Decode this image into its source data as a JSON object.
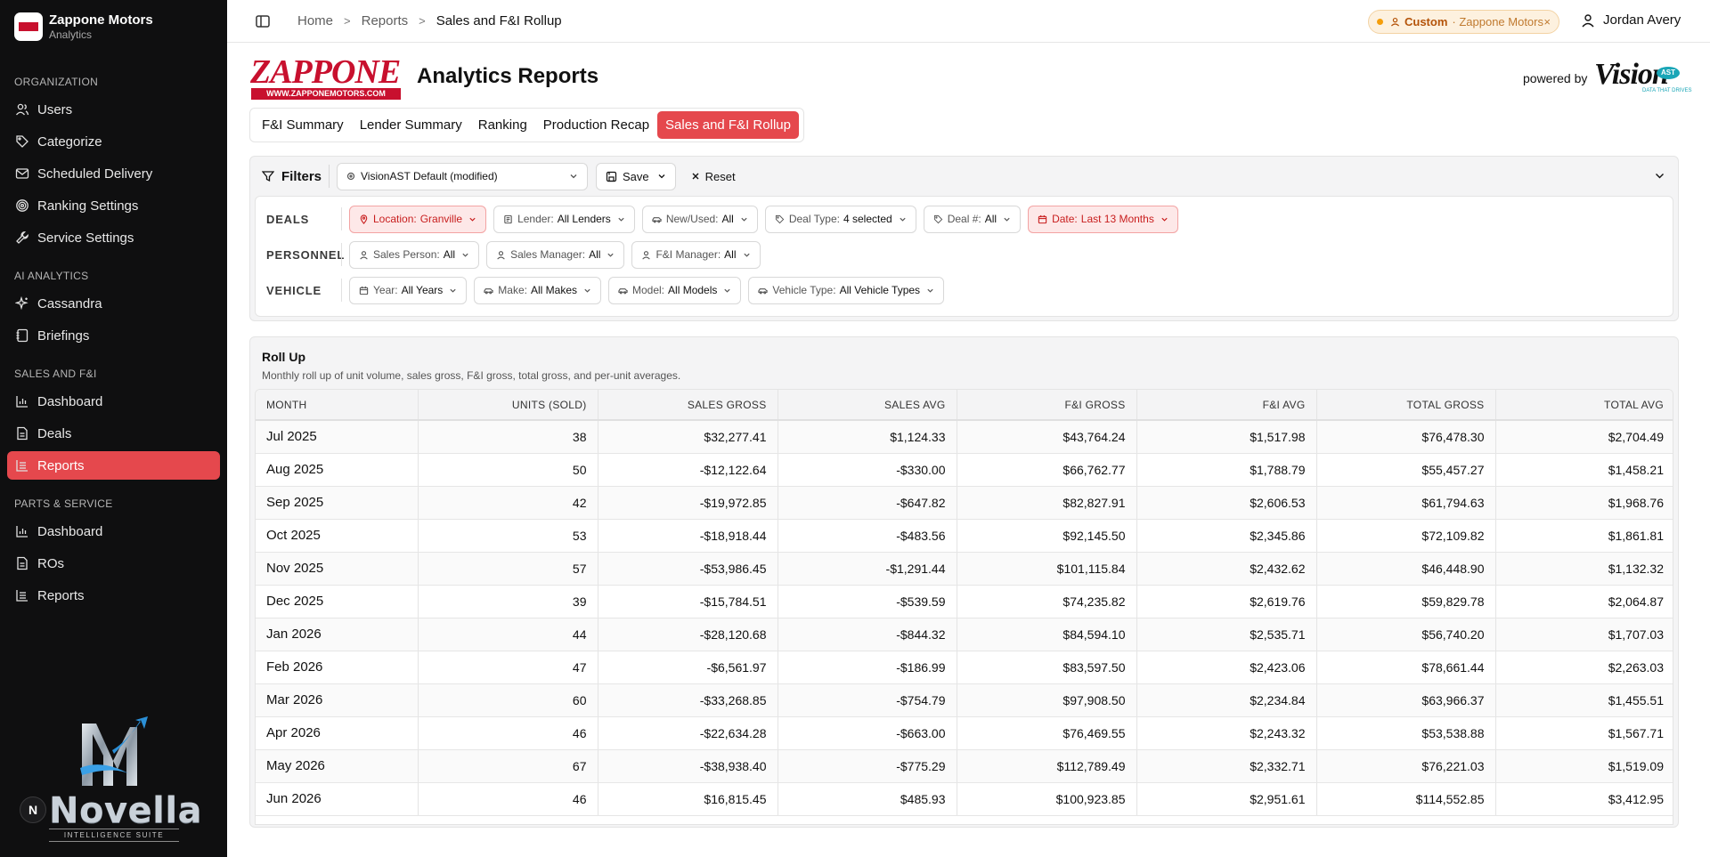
{
  "app": {
    "name": "Zappone Motors",
    "sub": "Analytics"
  },
  "sidebar": {
    "sections": [
      {
        "heading": "ORGANIZATION",
        "items": [
          {
            "label": "Users",
            "icon": "users-icon"
          },
          {
            "label": "Categorize",
            "icon": "tag-icon"
          },
          {
            "label": "Scheduled Delivery",
            "icon": "mail-icon"
          },
          {
            "label": "Ranking Settings",
            "icon": "target-icon"
          },
          {
            "label": "Service Settings",
            "icon": "wrench-icon"
          }
        ]
      },
      {
        "heading": "AI ANALYTICS",
        "items": [
          {
            "label": "Cassandra",
            "icon": "sparkles-icon"
          },
          {
            "label": "Briefings",
            "icon": "notebook-icon"
          }
        ]
      },
      {
        "heading": "SALES AND F&I",
        "items": [
          {
            "label": "Dashboard",
            "icon": "bar-chart-icon"
          },
          {
            "label": "Deals",
            "icon": "document-icon"
          },
          {
            "label": "Reports",
            "icon": "line-chart-icon",
            "active": true
          }
        ]
      },
      {
        "heading": "PARTS & SERVICE",
        "items": [
          {
            "label": "Dashboard",
            "icon": "bar-chart-icon"
          },
          {
            "label": "ROs",
            "icon": "document-icon"
          },
          {
            "label": "Reports",
            "icon": "line-chart-icon"
          }
        ]
      }
    ],
    "footer": {
      "brand": "Novella",
      "tagline": "INTELLIGENCE SUITE",
      "user_initial": "N"
    }
  },
  "topbar": {
    "breadcrumb": [
      "Home",
      "Reports",
      "Sales and F&I Rollup"
    ],
    "badge": {
      "strong": "Custom",
      "muted": "· Zappone Motors",
      "close": "×"
    },
    "user": "Jordan Avery"
  },
  "header": {
    "logo_text": "ZAPPONE",
    "logo_url": "WWW.ZAPPONEMOTORS.COM",
    "title": "Analytics Reports",
    "powered_by": "powered by",
    "partner": {
      "word": "Vision",
      "badge": "AST",
      "tagline": "DATA THAT DRIVES"
    }
  },
  "tabs": [
    {
      "label": "F&I Summary"
    },
    {
      "label": "Lender Summary"
    },
    {
      "label": "Ranking"
    },
    {
      "label": "Production Recap"
    },
    {
      "label": "Sales and F&I Rollup",
      "active": true
    }
  ],
  "filters": {
    "label": "Filters",
    "preset": "VisionAST Default (modified)",
    "save": "Save",
    "reset": "Reset",
    "rows": [
      {
        "label": "DEALS",
        "chips": [
          {
            "key": "Location:",
            "value": "Granville",
            "icon": "pin-icon",
            "highlight": true
          },
          {
            "key": "Lender:",
            "value": "All Lenders",
            "icon": "bank-icon"
          },
          {
            "key": "New/Used:",
            "value": "All",
            "icon": "car-icon"
          },
          {
            "key": "Deal Type:",
            "value": "4 selected",
            "icon": "tag-icon"
          },
          {
            "key": "Deal #:",
            "value": "All",
            "icon": "tag-icon"
          },
          {
            "key": "Date:",
            "value": "Last 13 Months",
            "icon": "calendar-icon",
            "highlight": true
          }
        ]
      },
      {
        "label": "PERSONNEL",
        "chips": [
          {
            "key": "Sales Person:",
            "value": "All",
            "icon": "person-icon"
          },
          {
            "key": "Sales Manager:",
            "value": "All",
            "icon": "person-icon"
          },
          {
            "key": "F&I Manager:",
            "value": "All",
            "icon": "person-icon"
          }
        ]
      },
      {
        "label": "VEHICLE",
        "chips": [
          {
            "key": "Year:",
            "value": "All Years",
            "icon": "calendar-icon"
          },
          {
            "key": "Make:",
            "value": "All Makes",
            "icon": "car-icon"
          },
          {
            "key": "Model:",
            "value": "All Models",
            "icon": "car-icon"
          },
          {
            "key": "Vehicle Type:",
            "value": "All Vehicle Types",
            "icon": "car-icon"
          }
        ]
      }
    ]
  },
  "rollup": {
    "title": "Roll Up",
    "description": "Monthly roll up of unit volume, sales gross, F&I gross, total gross, and per-unit averages.",
    "columns": [
      "MONTH",
      "UNITS (SOLD)",
      "SALES GROSS",
      "SALES AVG",
      "F&I GROSS",
      "F&I AVG",
      "TOTAL GROSS",
      "TOTAL AVG"
    ],
    "rows": [
      [
        "Jul 2025",
        "38",
        "$32,277.41",
        "$1,124.33",
        "$43,764.24",
        "$1,517.98",
        "$76,478.30",
        "$2,704.49"
      ],
      [
        "Aug 2025",
        "50",
        "-$12,122.64",
        "-$330.00",
        "$66,762.77",
        "$1,788.79",
        "$55,457.27",
        "$1,458.21"
      ],
      [
        "Sep 2025",
        "42",
        "-$19,972.85",
        "-$647.82",
        "$82,827.91",
        "$2,606.53",
        "$61,794.63",
        "$1,968.76"
      ],
      [
        "Oct 2025",
        "53",
        "-$18,918.44",
        "-$483.56",
        "$92,145.50",
        "$2,345.86",
        "$72,109.82",
        "$1,861.81"
      ],
      [
        "Nov 2025",
        "57",
        "-$53,986.45",
        "-$1,291.44",
        "$101,115.84",
        "$2,432.62",
        "$46,448.90",
        "$1,132.32"
      ],
      [
        "Dec 2025",
        "39",
        "-$15,784.51",
        "-$539.59",
        "$74,235.82",
        "$2,619.76",
        "$59,829.78",
        "$2,064.87"
      ],
      [
        "Jan 2026",
        "44",
        "-$28,120.68",
        "-$844.32",
        "$84,594.10",
        "$2,535.71",
        "$56,740.20",
        "$1,707.03"
      ],
      [
        "Feb 2026",
        "47",
        "-$6,561.97",
        "-$186.99",
        "$83,597.50",
        "$2,423.06",
        "$78,661.44",
        "$2,263.03"
      ],
      [
        "Mar 2026",
        "60",
        "-$33,268.85",
        "-$754.79",
        "$97,908.50",
        "$2,234.84",
        "$63,966.37",
        "$1,455.51"
      ],
      [
        "Apr 2026",
        "46",
        "-$22,634.28",
        "-$663.00",
        "$76,469.55",
        "$2,243.32",
        "$53,538.88",
        "$1,567.71"
      ],
      [
        "May 2026",
        "67",
        "-$38,938.40",
        "-$775.29",
        "$112,789.49",
        "$2,332.71",
        "$76,221.03",
        "$1,519.09"
      ],
      [
        "Jun 2026",
        "46",
        "$16,815.45",
        "$485.93",
        "$100,923.85",
        "$2,951.61",
        "$114,552.85",
        "$3,412.95"
      ]
    ]
  },
  "colors": {
    "accent": "#e5484d",
    "sidebar_bg": "#0f0f10",
    "brand_red": "#c8102e",
    "badge_bg": "#fdf1df"
  }
}
